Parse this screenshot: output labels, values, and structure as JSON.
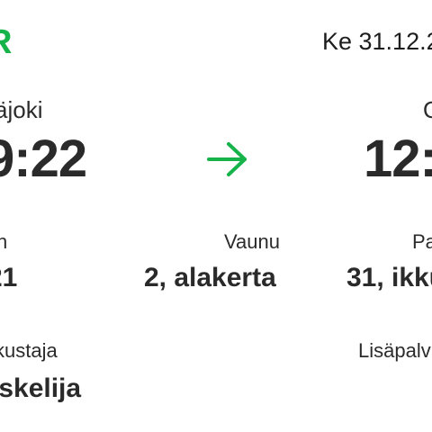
{
  "header": {
    "logo_text": "R",
    "date": "Ke 31.12.2"
  },
  "journey": {
    "departure_station": "äjoki",
    "departure_time": "9:22",
    "arrival_station": "O",
    "arrival_time": "12:1",
    "arrow_icon": "arrow-right-icon",
    "accent_color": "#16b34a"
  },
  "details": {
    "train_label": "n",
    "train_value": "21",
    "car_label": "Vaunu",
    "car_value": "2, alakerta",
    "seat_label": "Pa",
    "seat_value": "31, ikku",
    "traveller_label": "kustaja",
    "traveller_value": "iskelija",
    "extras_label": "Lisäpalv"
  }
}
